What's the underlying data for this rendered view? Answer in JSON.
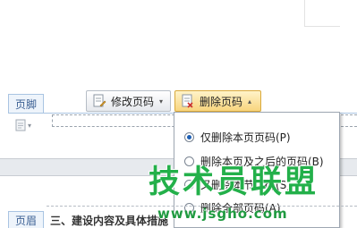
{
  "footer": {
    "tab_label": "页脚",
    "page_number_icon": "page-number-icon"
  },
  "toolbar": {
    "modify_label": "修改页码",
    "modify_icon": "edit-page-number-icon",
    "delete_label": "删除页码",
    "delete_icon": "delete-page-number-icon"
  },
  "delete_menu": {
    "items": [
      {
        "label": "仅删除本页页码(P)",
        "selected": true
      },
      {
        "label": "删除本页及之后的页码(B)",
        "selected": false
      },
      {
        "label": "又删除本节页码(S)",
        "selected": false
      },
      {
        "label": "删除全部页码(A)",
        "selected": false
      }
    ]
  },
  "header": {
    "tab_label": "页眉",
    "text": "三、建设内容及具体措施"
  },
  "watermark": {
    "main": "技术员联盟",
    "url": "www.jsgho.com"
  },
  "colors": {
    "accent_blue": "#3b5f93",
    "watermark_green": "#23b04a",
    "active_button": "#f8d57e"
  }
}
